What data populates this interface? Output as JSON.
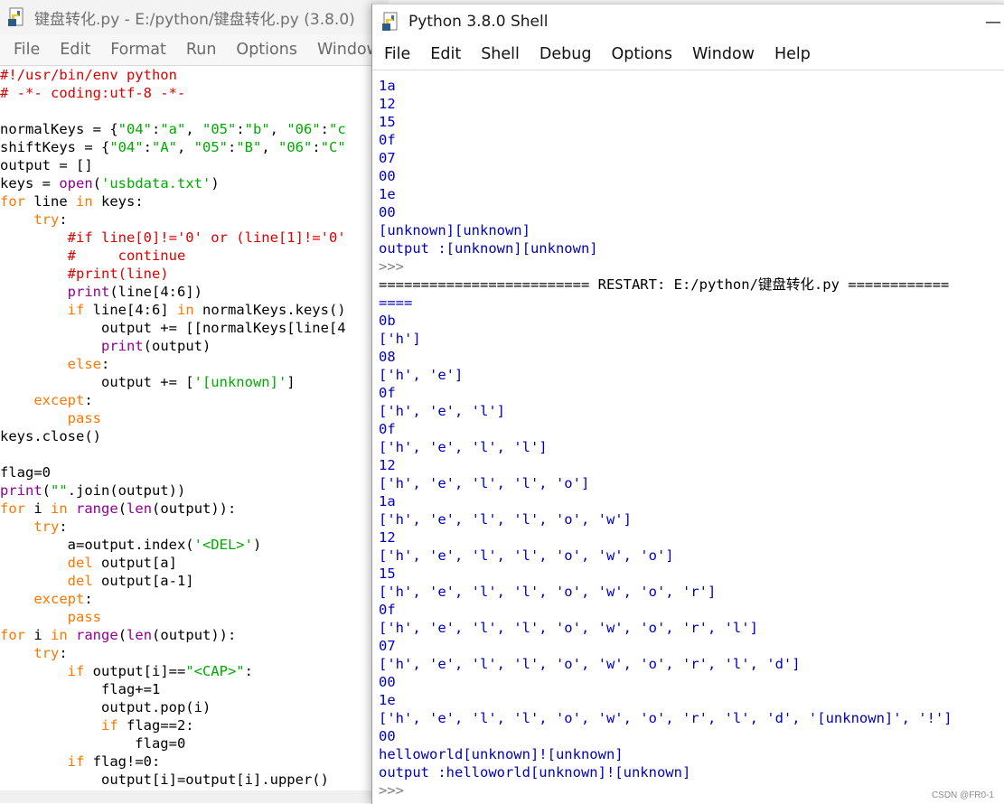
{
  "editor": {
    "title": "键盘转化.py - E:/python/键盘转化.py (3.8.0)",
    "menu": [
      "File",
      "Edit",
      "Format",
      "Run",
      "Options",
      "Window"
    ],
    "code": [
      [
        {
          "c": "c",
          "t": "#!/usr/bin/env python"
        }
      ],
      [
        {
          "c": "c",
          "t": "# -*- coding:utf-8 -*-"
        }
      ],
      [],
      [
        {
          "t": "normalKeys = {"
        },
        {
          "c": "s",
          "t": "\"04\""
        },
        {
          "t": ":"
        },
        {
          "c": "s",
          "t": "\"a\""
        },
        {
          "t": ", "
        },
        {
          "c": "s",
          "t": "\"05\""
        },
        {
          "t": ":"
        },
        {
          "c": "s",
          "t": "\"b\""
        },
        {
          "t": ", "
        },
        {
          "c": "s",
          "t": "\"06\""
        },
        {
          "t": ":"
        },
        {
          "c": "s",
          "t": "\"c"
        }
      ],
      [
        {
          "t": "shiftKeys = {"
        },
        {
          "c": "s",
          "t": "\"04\""
        },
        {
          "t": ":"
        },
        {
          "c": "s",
          "t": "\"A\""
        },
        {
          "t": ", "
        },
        {
          "c": "s",
          "t": "\"05\""
        },
        {
          "t": ":"
        },
        {
          "c": "s",
          "t": "\"B\""
        },
        {
          "t": ", "
        },
        {
          "c": "s",
          "t": "\"06\""
        },
        {
          "t": ":"
        },
        {
          "c": "s",
          "t": "\"C\""
        }
      ],
      [
        {
          "t": "output = []"
        }
      ],
      [
        {
          "t": "keys = "
        },
        {
          "c": "b",
          "t": "open"
        },
        {
          "t": "("
        },
        {
          "c": "s",
          "t": "'usbdata.txt'"
        },
        {
          "t": ")"
        }
      ],
      [
        {
          "c": "k",
          "t": "for"
        },
        {
          "t": " line "
        },
        {
          "c": "k",
          "t": "in"
        },
        {
          "t": " keys:"
        }
      ],
      [
        {
          "t": "    "
        },
        {
          "c": "k",
          "t": "try"
        },
        {
          "t": ":"
        }
      ],
      [
        {
          "t": "        "
        },
        {
          "c": "c",
          "t": "#if line[0]!='0' or (line[1]!='0'"
        }
      ],
      [
        {
          "t": "        "
        },
        {
          "c": "c",
          "t": "#     continue"
        }
      ],
      [
        {
          "t": "        "
        },
        {
          "c": "c",
          "t": "#print(line)"
        }
      ],
      [
        {
          "t": "        "
        },
        {
          "c": "b",
          "t": "print"
        },
        {
          "t": "(line[4:6])"
        }
      ],
      [
        {
          "t": "        "
        },
        {
          "c": "k",
          "t": "if"
        },
        {
          "t": " line[4:6] "
        },
        {
          "c": "k",
          "t": "in"
        },
        {
          "t": " normalKeys.keys()"
        }
      ],
      [
        {
          "t": "            output += [[normalKeys[line[4"
        }
      ],
      [
        {
          "t": "            "
        },
        {
          "c": "b",
          "t": "print"
        },
        {
          "t": "(output)"
        }
      ],
      [
        {
          "t": "        "
        },
        {
          "c": "k",
          "t": "else"
        },
        {
          "t": ":"
        }
      ],
      [
        {
          "t": "            output += ["
        },
        {
          "c": "s",
          "t": "'[unknown]'"
        },
        {
          "t": "]"
        }
      ],
      [
        {
          "t": "    "
        },
        {
          "c": "k",
          "t": "except"
        },
        {
          "t": ":"
        }
      ],
      [
        {
          "t": "        "
        },
        {
          "c": "k",
          "t": "pass"
        }
      ],
      [
        {
          "t": "keys.close()"
        }
      ],
      [],
      [
        {
          "t": "flag=0"
        }
      ],
      [
        {
          "c": "b",
          "t": "print"
        },
        {
          "t": "("
        },
        {
          "c": "s",
          "t": "\"\""
        },
        {
          "t": ".join(output))"
        }
      ],
      [
        {
          "c": "k",
          "t": "for"
        },
        {
          "t": " i "
        },
        {
          "c": "k",
          "t": "in"
        },
        {
          "t": " "
        },
        {
          "c": "b",
          "t": "range"
        },
        {
          "t": "("
        },
        {
          "c": "b",
          "t": "len"
        },
        {
          "t": "(output)):"
        }
      ],
      [
        {
          "t": "    "
        },
        {
          "c": "k",
          "t": "try"
        },
        {
          "t": ":"
        }
      ],
      [
        {
          "t": "        a=output.index("
        },
        {
          "c": "s",
          "t": "'<DEL>'"
        },
        {
          "t": ")"
        }
      ],
      [
        {
          "t": "        "
        },
        {
          "c": "k",
          "t": "del"
        },
        {
          "t": " output[a]"
        }
      ],
      [
        {
          "t": "        "
        },
        {
          "c": "k",
          "t": "del"
        },
        {
          "t": " output[a-1]"
        }
      ],
      [
        {
          "t": "    "
        },
        {
          "c": "k",
          "t": "except"
        },
        {
          "t": ":"
        }
      ],
      [
        {
          "t": "        "
        },
        {
          "c": "k",
          "t": "pass"
        }
      ],
      [
        {
          "c": "k",
          "t": "for"
        },
        {
          "t": " i "
        },
        {
          "c": "k",
          "t": "in"
        },
        {
          "t": " "
        },
        {
          "c": "b",
          "t": "range"
        },
        {
          "t": "("
        },
        {
          "c": "b",
          "t": "len"
        },
        {
          "t": "(output)):"
        }
      ],
      [
        {
          "t": "    "
        },
        {
          "c": "k",
          "t": "try"
        },
        {
          "t": ":"
        }
      ],
      [
        {
          "t": "        "
        },
        {
          "c": "k",
          "t": "if"
        },
        {
          "t": " output[i]=="
        },
        {
          "c": "s",
          "t": "\"<CAP>\""
        },
        {
          "t": ":"
        }
      ],
      [
        {
          "t": "            flag+=1"
        }
      ],
      [
        {
          "t": "            output.pop(i)"
        }
      ],
      [
        {
          "t": "            "
        },
        {
          "c": "k",
          "t": "if"
        },
        {
          "t": " flag==2:"
        }
      ],
      [
        {
          "t": "                flag=0"
        }
      ],
      [
        {
          "t": "        "
        },
        {
          "c": "k",
          "t": "if"
        },
        {
          "t": " flag!=0:"
        }
      ],
      [
        {
          "t": "            output[i]=output[i].upper()"
        }
      ]
    ]
  },
  "shell": {
    "title": "Python 3.8.0 Shell",
    "minimize": "—",
    "menu": [
      "File",
      "Edit",
      "Shell",
      "Debug",
      "Options",
      "Window",
      "Help"
    ],
    "lines": [
      {
        "c": "out",
        "t": "1a"
      },
      {
        "c": "out",
        "t": "12"
      },
      {
        "c": "out",
        "t": "15"
      },
      {
        "c": "out",
        "t": "0f"
      },
      {
        "c": "out",
        "t": "07"
      },
      {
        "c": "out",
        "t": "00"
      },
      {
        "c": "out",
        "t": "1e"
      },
      {
        "c": "out",
        "t": "00"
      },
      {
        "c": "out",
        "t": "[unknown][unknown]"
      },
      {
        "c": "out",
        "t": "output :[unknown][unknown]"
      },
      {
        "c": "prm",
        "t": ">>>"
      },
      {
        "c": "restart",
        "t": "========================= RESTART: E:/python/键盘转化.py ============"
      },
      {
        "c": "out",
        "t": "===="
      },
      {
        "c": "out",
        "t": "0b"
      },
      {
        "c": "out",
        "t": "['h']"
      },
      {
        "c": "out",
        "t": "08"
      },
      {
        "c": "out",
        "t": "['h', 'e']"
      },
      {
        "c": "out",
        "t": "0f"
      },
      {
        "c": "out",
        "t": "['h', 'e', 'l']"
      },
      {
        "c": "out",
        "t": "0f"
      },
      {
        "c": "out",
        "t": "['h', 'e', 'l', 'l']"
      },
      {
        "c": "out",
        "t": "12"
      },
      {
        "c": "out",
        "t": "['h', 'e', 'l', 'l', 'o']"
      },
      {
        "c": "out",
        "t": "1a"
      },
      {
        "c": "out",
        "t": "['h', 'e', 'l', 'l', 'o', 'w']"
      },
      {
        "c": "out",
        "t": "12"
      },
      {
        "c": "out",
        "t": "['h', 'e', 'l', 'l', 'o', 'w', 'o']"
      },
      {
        "c": "out",
        "t": "15"
      },
      {
        "c": "out",
        "t": "['h', 'e', 'l', 'l', 'o', 'w', 'o', 'r']"
      },
      {
        "c": "out",
        "t": "0f"
      },
      {
        "c": "out",
        "t": "['h', 'e', 'l', 'l', 'o', 'w', 'o', 'r', 'l']"
      },
      {
        "c": "out",
        "t": "07"
      },
      {
        "c": "out",
        "t": "['h', 'e', 'l', 'l', 'o', 'w', 'o', 'r', 'l', 'd']"
      },
      {
        "c": "out",
        "t": "00"
      },
      {
        "c": "out",
        "t": "1e"
      },
      {
        "c": "out",
        "t": "['h', 'e', 'l', 'l', 'o', 'w', 'o', 'r', 'l', 'd', '[unknown]', '!']"
      },
      {
        "c": "out",
        "t": "00"
      },
      {
        "c": "out",
        "t": "helloworld[unknown]![unknown]"
      },
      {
        "c": "out",
        "t": "output :helloworld[unknown]![unknown]"
      },
      {
        "c": "prm",
        "t": ">>>"
      }
    ]
  },
  "watermark": "CSDN @FR0-1",
  "icons": {
    "app": "python-file-icon"
  }
}
